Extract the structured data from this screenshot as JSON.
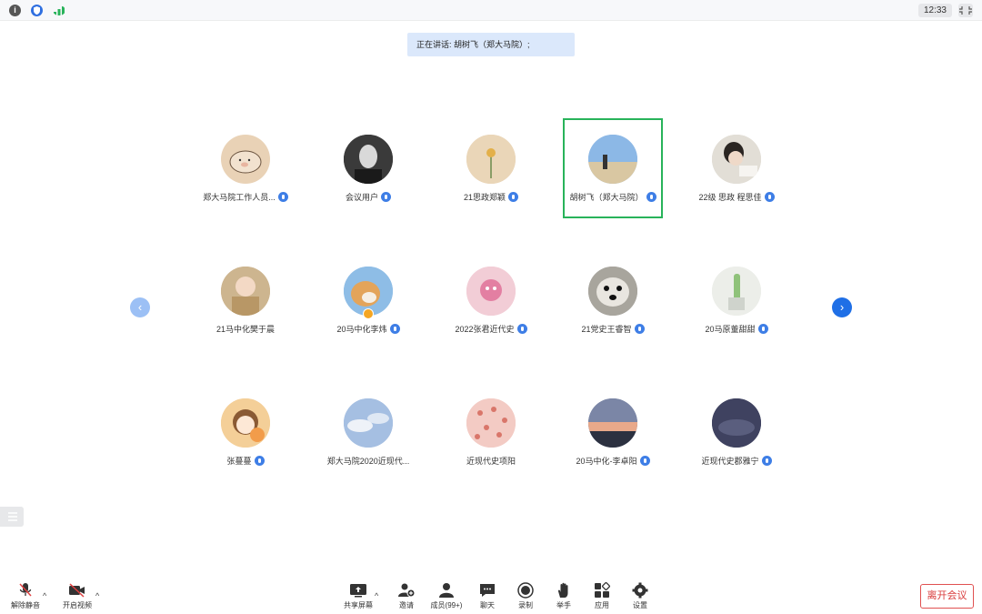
{
  "topbar": {
    "time": "12:33"
  },
  "speaking_banner": "正在讲话: 胡树飞（郑大马院）;",
  "participants": [
    {
      "name": "郑大马院工作人员..."
    },
    {
      "name": "会议用户"
    },
    {
      "name": "21思政郑颖"
    },
    {
      "name": "胡树飞（郑大马院）"
    },
    {
      "name": "22级 思政 程思佳"
    },
    {
      "name": "21马中化樊于晨"
    },
    {
      "name": "20马中化李炜"
    },
    {
      "name": "2022张君近代史"
    },
    {
      "name": "21党史王睿智"
    },
    {
      "name": "20马原董甜甜"
    },
    {
      "name": "张蔓蔓"
    },
    {
      "name": "郑大马院2020近现代..."
    },
    {
      "name": "近现代史项阳"
    },
    {
      "name": "20马中化-李卓阳"
    },
    {
      "name": "近现代史郡雅宁"
    }
  ],
  "toolbar": {
    "mute": "解除静音",
    "video": "开启视频",
    "share": "共享屏幕",
    "invite": "邀请",
    "members": "成员(99+)",
    "chat": "聊天",
    "record": "录制",
    "raise_hand": "举手",
    "apps": "应用",
    "settings": "设置",
    "leave": "离开会议"
  },
  "colors": {
    "accent": "#1f6fe6",
    "active_border": "#28b35a",
    "leave": "#d93a3a"
  }
}
